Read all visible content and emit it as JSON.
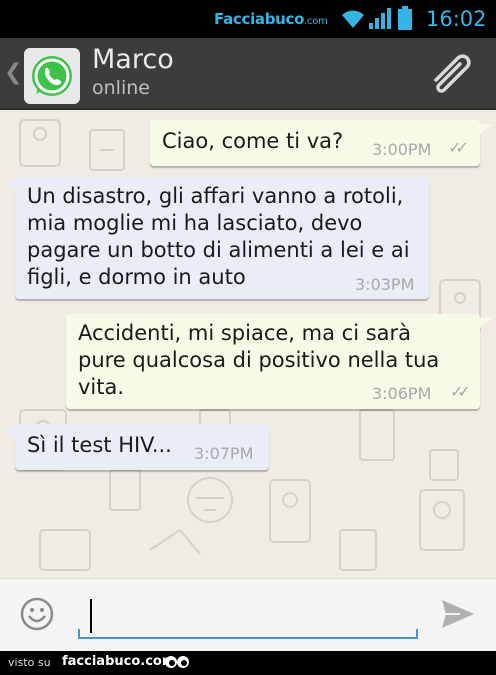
{
  "status_bar": {
    "brand": "Facciabuco",
    "brand_suffix": ".com",
    "time": "16:02",
    "accent_color": "#33b5e5"
  },
  "header": {
    "back_icon": "chevron-left-icon",
    "app_icon": "whatsapp-icon",
    "contact_name": "Marco",
    "contact_status": "online",
    "attach_icon": "paperclip-icon"
  },
  "messages": [
    {
      "direction": "out",
      "text": "Ciao, come ti va?",
      "time": "3:00PM",
      "ticks": "✓✓"
    },
    {
      "direction": "in",
      "lines": [
        "Un disastro, gli affari vanno a rotoli,",
        "mia moglie mi ha lasciato, devo",
        "pagare un botto di alimenti a lei e ai",
        "figli, e dormo in auto"
      ],
      "time": "3:03PM"
    },
    {
      "direction": "out",
      "lines": [
        "Accidenti, mi spiace, ma ci sarà",
        "pure qualcosa di positivo nella tua",
        "vita."
      ],
      "time": "3:06PM",
      "ticks": "✓✓"
    },
    {
      "direction": "in",
      "text": "Sì il test HIV...",
      "time": "3:07PM"
    }
  ],
  "composer": {
    "emoji_icon": "smiley-icon",
    "input_value": "",
    "send_icon": "send-icon"
  },
  "footer": {
    "visto": "visto su",
    "site": "facciabuco.com"
  }
}
